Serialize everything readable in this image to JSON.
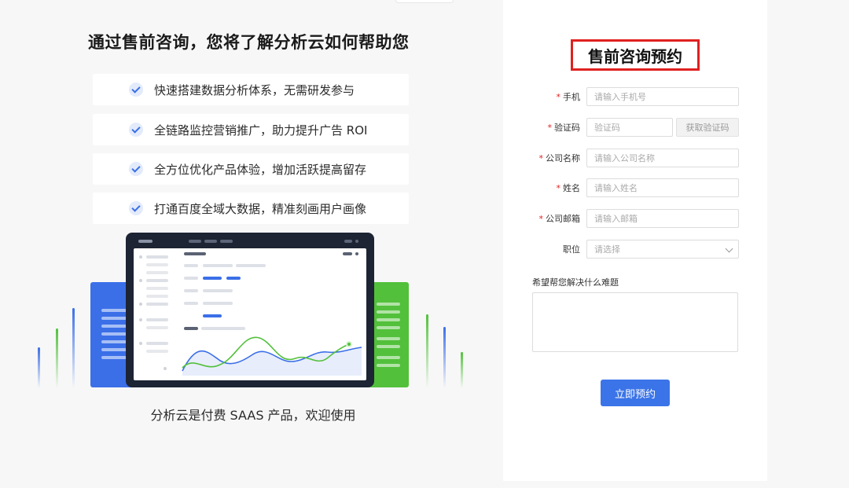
{
  "left": {
    "title": "通过售前咨询，您将了解分析云如何帮助您",
    "features": [
      "快速搭建数据分析体系，无需研发参与",
      "全链路监控营销推广，助力提升广告 ROI",
      "全方位优化产品体验，增加活跃提高留存",
      "打通百度全域大数据，精准刻画用户画像"
    ],
    "tagline": "分析云是付费 SAAS 产品，欢迎使用"
  },
  "form": {
    "title": "售前咨询预约",
    "required_mark": "*",
    "fields": {
      "phone": {
        "label": "手机",
        "placeholder": "请输入手机号"
      },
      "code": {
        "label": "验证码",
        "placeholder": "验证码",
        "button": "获取验证码"
      },
      "company": {
        "label": "公司名称",
        "placeholder": "请输入公司名称"
      },
      "name": {
        "label": "姓名",
        "placeholder": "请输入姓名"
      },
      "email": {
        "label": "公司邮箱",
        "placeholder": "请输入邮箱"
      },
      "position": {
        "label": "职位",
        "placeholder": "请选择"
      }
    },
    "question_label": "希望帮您解决什么难题",
    "submit_label": "立即预约"
  },
  "colors": {
    "accent": "#3b74e8",
    "highlight_border": "#e02020",
    "green": "#52c03b"
  }
}
